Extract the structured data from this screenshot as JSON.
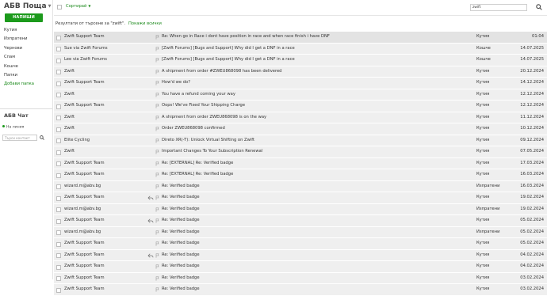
{
  "app": {
    "title": "АБВ Поща",
    "compose_label": "НАПИШИ"
  },
  "sidebar": {
    "folders": [
      {
        "label": "Кутия"
      },
      {
        "label": "Изпратени"
      },
      {
        "label": "Чернови"
      },
      {
        "label": "Спам"
      },
      {
        "label": "Кошче"
      },
      {
        "label": "Папки"
      }
    ],
    "add_folder": "Добави папка"
  },
  "chat": {
    "title": "АБВ Чат",
    "status": "На линия",
    "search_placeholder": "Търси контакт"
  },
  "toolbar": {
    "sort_label": "Сортирай",
    "search_value": "zwift"
  },
  "results": {
    "text": "Резултати от търсене за \"zwift\".",
    "show_all": "Покажи всички"
  },
  "colors": {
    "accent": "#1c9a1c",
    "row_bg": "#efefef",
    "row_hover_bg": "#e3e3e3"
  },
  "emails": [
    {
      "sender": "Zwift Support Team",
      "subject": "Re: When go in Race i dont have position in race and when race finish i have DNF",
      "folder": "Кутия",
      "date": "01:04",
      "replied": false
    },
    {
      "sender": "Sue via Zwift Forums",
      "subject": "[Zwift Forums] [Bugs and Support] Why did I get a DNF in a race",
      "folder": "Кошче",
      "date": "14.07.2025",
      "replied": false
    },
    {
      "sender": "Lee via Zwift Forums",
      "subject": "[Zwift Forums] [Bugs and Support] Why did I get a DNF in a race",
      "folder": "Кошче",
      "date": "14.07.2025",
      "replied": false
    },
    {
      "sender": "Zwift",
      "subject": "A shipment from order #ZWEU868098 has been delivered",
      "folder": "Кутия",
      "date": "20.12.2024",
      "replied": false
    },
    {
      "sender": "Zwift Support Team",
      "subject": "How'd we do?",
      "folder": "Кутия",
      "date": "14.12.2024",
      "replied": false
    },
    {
      "sender": "Zwift",
      "subject": "You have a refund coming your way",
      "folder": "Кутия",
      "date": "12.12.2024",
      "replied": false
    },
    {
      "sender": "Zwift Support Team",
      "subject": "Oops! We've Fixed Your Shipping Charge",
      "folder": "Кутия",
      "date": "12.12.2024",
      "replied": false
    },
    {
      "sender": "Zwift",
      "subject": "A shipment from order ZWEU868098 is on the way",
      "folder": "Кутия",
      "date": "11.12.2024",
      "replied": false
    },
    {
      "sender": "Zwift",
      "subject": "Order ZWEU868098 confirmed",
      "folder": "Кутия",
      "date": "10.12.2024",
      "replied": false
    },
    {
      "sender": "Elite Cycling",
      "subject": "Direto XR(-T): Unlock Virtual Shifting on Zwift",
      "folder": "Кутия",
      "date": "09.12.2024",
      "replied": false
    },
    {
      "sender": "Zwift",
      "subject": "Important Changes To Your Subscription Renewal",
      "folder": "Кутия",
      "date": "07.05.2024",
      "replied": false
    },
    {
      "sender": "Zwift Support Team",
      "subject": "Re: [EXTERNAL] Re: Verified badge",
      "folder": "Кутия",
      "date": "17.03.2024",
      "replied": false
    },
    {
      "sender": "Zwift Support Team",
      "subject": "Re: [EXTERNAL] Re: Verified badge",
      "folder": "Кутия",
      "date": "16.03.2024",
      "replied": false
    },
    {
      "sender": "wizard.m@abv.bg",
      "subject": "Re: Verified badge",
      "folder": "Изпратени",
      "date": "16.03.2024",
      "replied": false
    },
    {
      "sender": "Zwift Support Team",
      "subject": "Re: Verified badge",
      "folder": "Кутия",
      "date": "19.02.2024",
      "replied": true
    },
    {
      "sender": "wizard.m@abv.bg",
      "subject": "Re: Verified badge",
      "folder": "Изпратени",
      "date": "19.02.2024",
      "replied": false
    },
    {
      "sender": "Zwift Support Team",
      "subject": "Re: Verified badge",
      "folder": "Кутия",
      "date": "05.02.2024",
      "replied": true
    },
    {
      "sender": "wizard.m@abv.bg",
      "subject": "Re: Verified badge",
      "folder": "Изпратени",
      "date": "05.02.2024",
      "replied": false
    },
    {
      "sender": "Zwift Support Team",
      "subject": "Re: Verified badge",
      "folder": "Кутия",
      "date": "05.02.2024",
      "replied": false
    },
    {
      "sender": "Zwift Support Team",
      "subject": "Re: Verified badge",
      "folder": "Кутия",
      "date": "04.02.2024",
      "replied": true
    },
    {
      "sender": "Zwift Support Team",
      "subject": "Re: Verified badge",
      "folder": "Кутия",
      "date": "04.02.2024",
      "replied": false
    },
    {
      "sender": "Zwift Support Team",
      "subject": "Re: Verified badge",
      "folder": "Кутия",
      "date": "03.02.2024",
      "replied": false
    },
    {
      "sender": "Zwift Support Team",
      "subject": "Re: Verified badge",
      "folder": "Кутия",
      "date": "03.02.2024",
      "replied": false
    }
  ]
}
